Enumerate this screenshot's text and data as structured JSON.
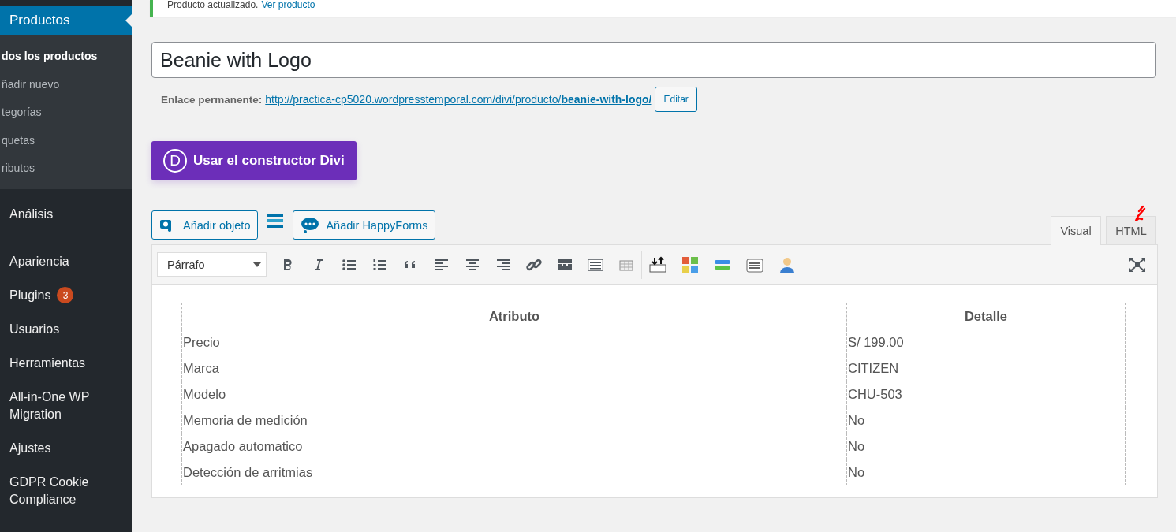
{
  "sidebar": {
    "current": {
      "label": "Productos",
      "selected": true
    },
    "submenu": [
      {
        "label": "dos los productos",
        "selected": true
      },
      {
        "label": "ñadir nuevo",
        "selected": false
      },
      {
        "label": "tegorías",
        "selected": false
      },
      {
        "label": "quetas",
        "selected": false
      },
      {
        "label": "ributos",
        "selected": false
      }
    ],
    "items": [
      {
        "label": "Análisis"
      },
      {
        "label": "Apariencia"
      },
      {
        "label": "Plugins",
        "badge": "3"
      },
      {
        "label": "Usuarios"
      },
      {
        "label": "Herramientas"
      },
      {
        "label": "All-in-One WP Migration"
      },
      {
        "label": "Ajustes"
      },
      {
        "label": "GDPR Cookie Compliance"
      }
    ]
  },
  "notice": {
    "text": "Producto actualizado.",
    "link": "Ver producto"
  },
  "title_field": {
    "value": "Beanie with Logo"
  },
  "permalink": {
    "label": "Enlace permanente:",
    "url_start": "http://practica-cp5020.wordpresstemporal.com/divi/producto/",
    "slug": "beanie-with-logo/",
    "edit_button": "Editar"
  },
  "divi_button": {
    "logo": "D",
    "label": "Usar el constructor Divi"
  },
  "media_buttons": [
    {
      "label": "Añadir objeto",
      "kind": "media"
    },
    {
      "label": "Añadir HappyForms",
      "kind": "forms"
    }
  ],
  "editor_tabs": [
    {
      "label": "Visual",
      "selected": true
    },
    {
      "label": "HTML",
      "selected": false
    }
  ],
  "toolbar": {
    "format_select": "Párrafo"
  },
  "table": {
    "columns": [
      "Atributo",
      "Detalle"
    ],
    "rows": [
      [
        "Precio",
        "S/ 199.00"
      ],
      [
        "Marca",
        "CITIZEN"
      ],
      [
        "Modelo",
        "CHU-503"
      ],
      [
        "Memoria de medición",
        "No"
      ],
      [
        "Apagado automatico",
        "No"
      ],
      [
        "Detección de arritmias",
        "No"
      ]
    ]
  }
}
